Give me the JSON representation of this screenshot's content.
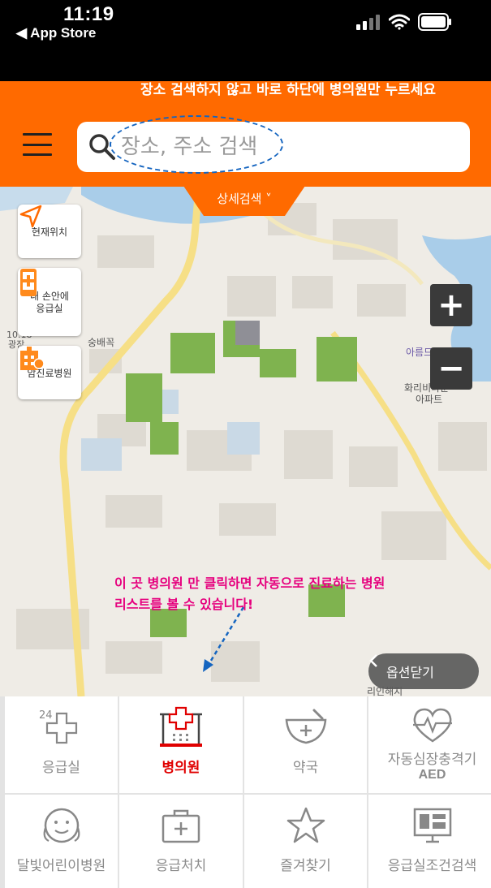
{
  "status_bar": {
    "time": "11:19",
    "back_label": "◀ App Store"
  },
  "header": {
    "notice": "장소 검색하지 않고 바로 하단에 병의원만 누르세요",
    "search_placeholder": "장소, 주소 검색",
    "detail_search_label": "상세검색 ˅",
    "accent_color": "#ff6a00"
  },
  "map": {
    "side_buttons": [
      {
        "label": "현재위치",
        "icon": "location-arrow-icon"
      },
      {
        "label": "내 손안에\n응급실",
        "icon": "phone-cross-icon"
      },
      {
        "label": "암진료병원",
        "icon": "cancer-hospital-icon"
      }
    ],
    "zoom_in": "+",
    "zoom_out": "−",
    "annotation_line1": "이 곳 병의원 만 클릭하면 자동으로 진료하는 병원",
    "annotation_line2": "리스트를 볼 수 있습니다!",
    "option_close_label": "옵션닫기",
    "place_labels": {
      "a": "아름드림",
      "b": "화리비타운",
      "c": "아파트",
      "d": "숭배꼭",
      "e": "10.18",
      "f": "광장",
      "g": "리인해지"
    }
  },
  "categories": [
    {
      "label": "응급실",
      "icon": "emergency-24-icon",
      "active": false
    },
    {
      "label": "병의원",
      "icon": "hospital-icon",
      "active": true
    },
    {
      "label": "약국",
      "icon": "pharmacy-icon",
      "active": false
    },
    {
      "label": "자동심장충격기",
      "sub": "AED",
      "icon": "aed-heart-icon",
      "active": false
    },
    {
      "label": "달빛어린이병원",
      "icon": "moon-child-icon",
      "active": false
    },
    {
      "label": "응급처치",
      "icon": "first-aid-kit-icon",
      "active": false
    },
    {
      "label": "즐겨찾기",
      "icon": "star-icon",
      "active": false
    },
    {
      "label": "응급실조건검색",
      "icon": "condition-search-icon",
      "active": false
    }
  ],
  "colors": {
    "active_red": "#e00000",
    "annotation_pink": "#e6007e",
    "dashed_blue": "#1565c0"
  }
}
